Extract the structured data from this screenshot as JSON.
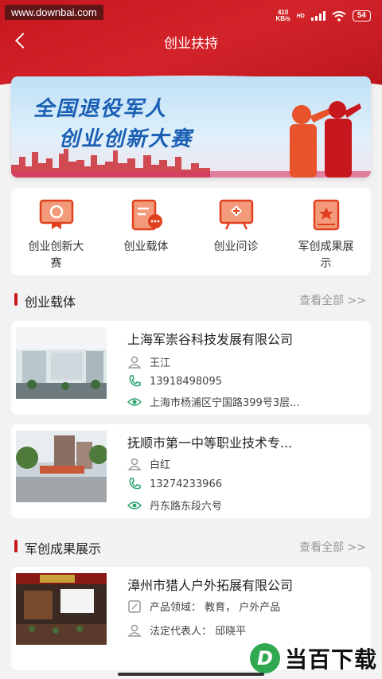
{
  "watermark": "www.downbai.com",
  "status": {
    "net_speed": "410",
    "net_unit": "KB/s",
    "hd": "HD",
    "battery": "54"
  },
  "header": {
    "title": "创业扶持"
  },
  "banner": {
    "line1": "全国退役军人",
    "line2": "创业创新大赛"
  },
  "categories": [
    {
      "label": "创业创新大赛",
      "icon": "certificate-icon"
    },
    {
      "label": "创业载体",
      "icon": "document-chat-icon"
    },
    {
      "label": "创业问诊",
      "icon": "medical-board-icon"
    },
    {
      "label": "军创成果展示",
      "icon": "star-book-icon"
    }
  ],
  "section1": {
    "title": "创业载体",
    "more": "查看全部 >>"
  },
  "carriers": [
    {
      "name": "上海军崇谷科技发展有限公司",
      "person": "王江",
      "phone": "13918498095",
      "address": "上海市杨浦区宁国路399号3层..."
    },
    {
      "name": "抚顺市第一中等职业技术专...",
      "person": "白红",
      "phone": "13274233966",
      "address": "丹东路东段六号"
    }
  ],
  "section2": {
    "title": "军创成果展示",
    "more": "查看全部 >>"
  },
  "achievements": [
    {
      "name": "漳州市猎人户外拓展有限公司",
      "field": "产品领域： 教育， 户外产品",
      "rep": "法定代表人： 邱晓平"
    }
  ],
  "footer_logo": {
    "letter": "D",
    "text": "当百下载"
  },
  "colors": {
    "brand_red": "#c8161d",
    "blue_text": "#1a5fb4"
  }
}
